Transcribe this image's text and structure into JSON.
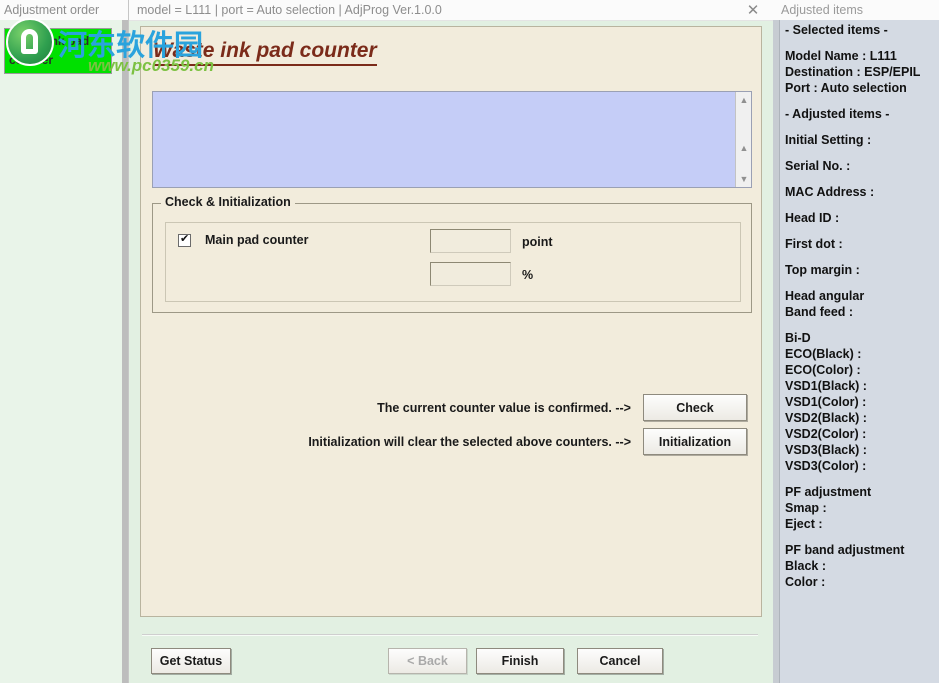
{
  "left_panel": {
    "titlebar": "Adjustment order",
    "selected_item": "Waste ink pad counter"
  },
  "main_window": {
    "titlebar": "model = L111 | port = Auto selection | AdjProg Ver.1.0.0",
    "close_icon": "close-icon",
    "heading": "Waste ink pad counter",
    "log_text": "",
    "groupbox": {
      "title": "Check & Initialization",
      "counter_label": "Main pad counter",
      "counter_checked": true,
      "point_value": "",
      "point_unit": "point",
      "percent_value": "",
      "percent_unit": "%"
    },
    "actions": [
      {
        "text": "The current counter value is confirmed. -->",
        "button": "Check"
      },
      {
        "text": "Initialization will clear the selected above counters. -->",
        "button": "Initialization"
      }
    ],
    "footer": {
      "get_status": "Get Status",
      "back": "< Back",
      "finish": "Finish",
      "cancel": "Cancel"
    }
  },
  "sidebar": {
    "titlebar": "Adjusted items",
    "lines": [
      "- Selected items -",
      "",
      "Model Name : L111",
      "Destination : ESP/EPIL",
      "Port : Auto selection",
      "",
      "- Adjusted items -",
      "",
      "Initial Setting :",
      "",
      "Serial No. :",
      "",
      "MAC Address :",
      "",
      "Head ID :",
      "",
      "First dot :",
      "",
      "Top margin :",
      "",
      "Head angular",
      " Band feed :",
      "",
      "Bi-D",
      " ECO(Black)  :",
      " ECO(Color)  :",
      " VSD1(Black) :",
      " VSD1(Color) :",
      " VSD2(Black) :",
      " VSD2(Color) :",
      " VSD3(Black) :",
      " VSD3(Color) :",
      "",
      "PF adjustment",
      "Smap :",
      "Eject :",
      "",
      "PF band adjustment",
      "Black :",
      "Color :"
    ]
  },
  "watermark": {
    "text_cn": "河东软件园",
    "text_url": "www.pc0359.cn",
    "logo_icon": "site-logo-icon"
  },
  "colors": {
    "window_bg": "#e2f0e2",
    "panel_bg": "#f2ecdc",
    "log_bg": "#c5cdf7",
    "heading": "#7b2b1a",
    "sidebar_bg": "#d4dae3",
    "selection": "#00e000"
  }
}
